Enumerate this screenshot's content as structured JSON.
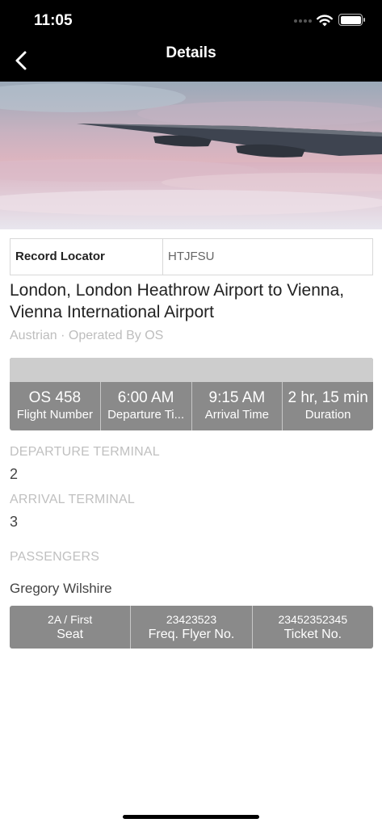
{
  "status_bar": {
    "time": "11:05"
  },
  "nav": {
    "title": "Details"
  },
  "record_locator": {
    "label": "Record Locator",
    "value": "HTJFSU"
  },
  "route": {
    "title": "London, London Heathrow Airport to Vienna, Vienna International Airport"
  },
  "airline": {
    "text": "Austrian · Operated By OS"
  },
  "flight_stats": [
    {
      "value": "OS 458",
      "label": "Flight Number"
    },
    {
      "value": "6:00 AM",
      "label": "Departure Ti..."
    },
    {
      "value": "9:15 AM",
      "label": "Arrival Time"
    },
    {
      "value": "2 hr, 15 min",
      "label": "Duration"
    }
  ],
  "departure_terminal": {
    "label": "DEPARTURE TERMINAL",
    "value": "2"
  },
  "arrival_terminal": {
    "label": "ARRIVAL TERMINAL",
    "value": "3"
  },
  "passengers": {
    "label": "PASSENGERS",
    "name": "Gregory Wilshire",
    "details": [
      {
        "value": "2A / First",
        "label": "Seat"
      },
      {
        "value": "23423523",
        "label": "Freq. Flyer No."
      },
      {
        "value": "23452352345",
        "label": "Ticket No."
      }
    ]
  },
  "icons": {
    "back": "chevron-left-icon",
    "wifi": "wifi-icon",
    "battery": "battery-icon",
    "signal": "cellular-signal-icon"
  }
}
